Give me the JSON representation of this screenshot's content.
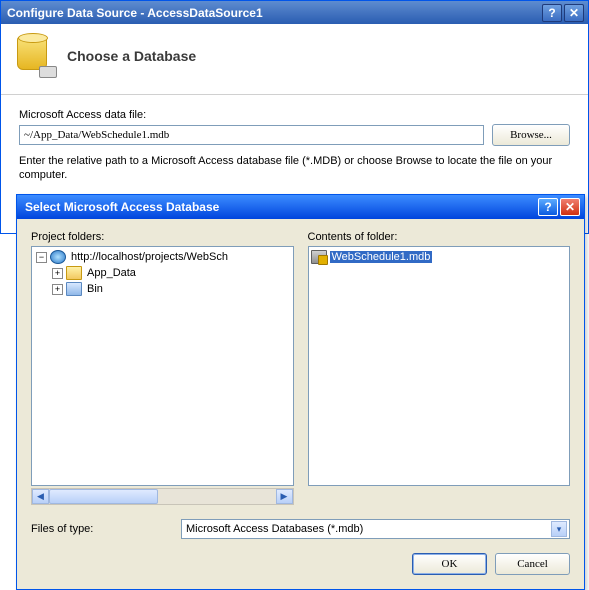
{
  "outer": {
    "title": "Configure Data Source - AccessDataSource1",
    "heading": "Choose a Database",
    "file_label": "Microsoft Access data file:",
    "file_value": "~/App_Data/WebSchedule1.mdb",
    "browse_label": "Browse...",
    "help_text": "Enter the relative path to a Microsoft Access database file (*.MDB) or choose Browse to locate the file on your computer."
  },
  "inner": {
    "title": "Select Microsoft Access Database",
    "folders_label": "Project folders:",
    "contents_label": "Contents of folder:",
    "tree": {
      "root": {
        "label": "http://localhost/projects/WebSch"
      },
      "children": [
        {
          "label": "App_Data"
        },
        {
          "label": "Bin"
        }
      ]
    },
    "files": [
      {
        "label": "WebSchedule1.mdb",
        "selected": true
      }
    ],
    "type_label": "Files of type:",
    "type_value": "Microsoft Access Databases (*.mdb)",
    "ok_label": "OK",
    "cancel_label": "Cancel"
  },
  "glyphs": {
    "help": "?",
    "close": "✕",
    "minus": "−",
    "plus": "+",
    "left": "◀",
    "right": "▶",
    "down": "▾"
  }
}
